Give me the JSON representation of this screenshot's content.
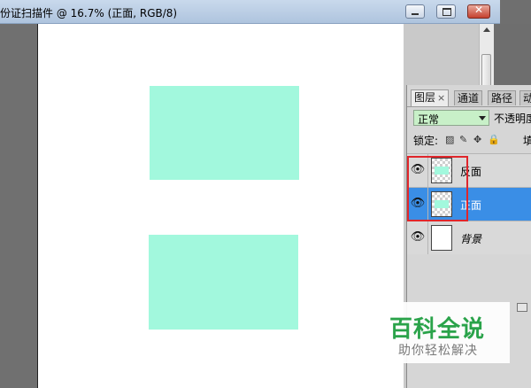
{
  "document": {
    "title": "份证扫描件 @ 16.7% (正面, RGB/8)"
  },
  "window_controls": {
    "minimize_label": "",
    "maximize_label": "",
    "close_label": "✕"
  },
  "canvas": {
    "background": "#ffffff",
    "card_color": "#a2f8dd"
  },
  "panel": {
    "tabs": [
      {
        "label": "图层",
        "close": "×"
      },
      {
        "label": "通道"
      },
      {
        "label": "路径"
      },
      {
        "label": "动"
      }
    ],
    "blend_mode": "正常",
    "opacity_label": "不透明度",
    "lock_label": "锁定:",
    "lock_icons": [
      "▨",
      "✎",
      "✥",
      "🔒"
    ],
    "fill_label": "填充",
    "layers": [
      {
        "name": "反面",
        "visible_icon": "👁",
        "selected": false
      },
      {
        "name": "正面",
        "visible_icon": "👁",
        "selected": true
      },
      {
        "name": "背景",
        "visible_icon": "👁",
        "selected": false
      }
    ]
  },
  "watermark": {
    "title": "百科全说",
    "subtitle": "助你轻松解决",
    "color": "#2aa34a"
  },
  "highlight_color": "#e0262b"
}
